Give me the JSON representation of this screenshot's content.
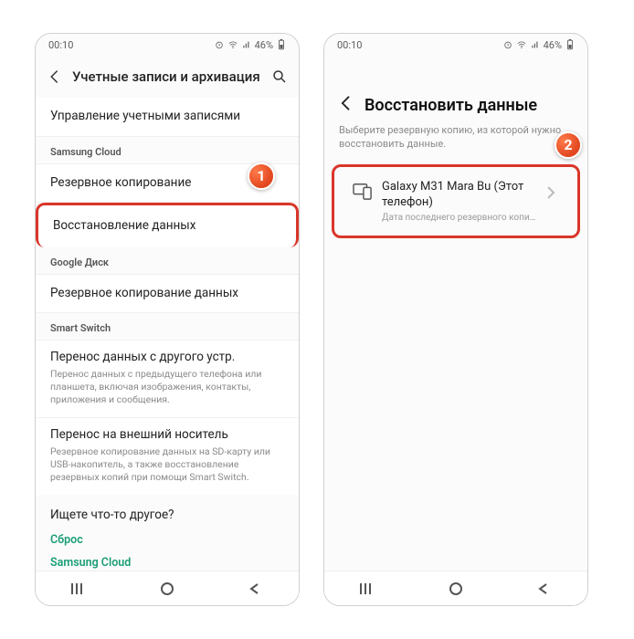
{
  "status": {
    "time": "00:10",
    "battery": "46%"
  },
  "left": {
    "title": "Учетные записи и архивация",
    "rows": {
      "manage": "Управление учетными записями"
    },
    "sections": {
      "samsung_cloud": "Samsung Cloud",
      "google_drive": "Google Диск",
      "smart_switch": "Smart Switch"
    },
    "samsung": {
      "backup": "Резервное копирование",
      "restore": "Восстановление данных"
    },
    "google": {
      "backup": "Резервное копирование данных"
    },
    "switch": {
      "transfer_title": "Перенос данных с другого устр.",
      "transfer_sub": "Перенос данных с предыдущего телефона или планшета, включая изображения, контакты, приложения и сообщения.",
      "external_title": "Перенос на внешний носитель",
      "external_sub": "Резервное копирование данных на SD-карту или USB-накопитель, а также восстановление резервных копий при помощи Smart Switch."
    },
    "helper": {
      "title": "Ищете что-то другое?",
      "link1": "Сброс",
      "link2": "Samsung Cloud"
    },
    "badge": "1"
  },
  "right": {
    "title": "Восстановить данные",
    "subtitle": "Выберите резервную копию, из которой нужно восстановить данные.",
    "device": {
      "name": "Galaxy M31 Mara Bu (Этот телефон)",
      "sub": "Дата последнего резервного копирования:..."
    },
    "badge": "2"
  }
}
